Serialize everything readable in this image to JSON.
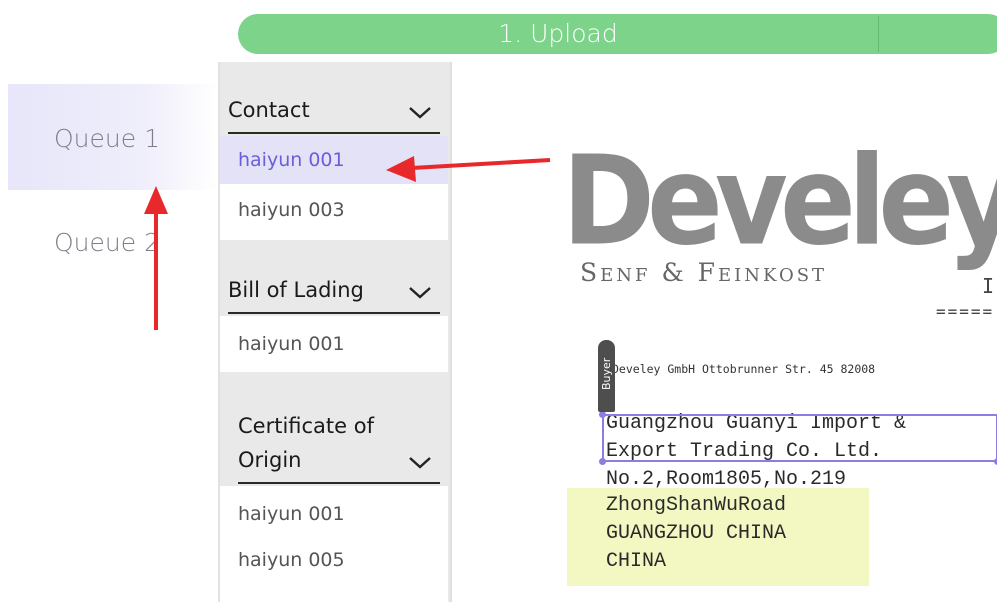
{
  "progress": {
    "step_label": "1. Upload"
  },
  "queues": [
    {
      "label": "Queue 1"
    },
    {
      "label": "Queue 2"
    }
  ],
  "groups": [
    {
      "title": "Contact",
      "items": [
        "haiyun 001",
        "haiyun 003"
      ]
    },
    {
      "title": "Bill of Lading",
      "items": [
        "haiyun 001"
      ]
    },
    {
      "title": "Certificate of Origin",
      "items": [
        "haiyun 001",
        "haiyun 005"
      ]
    }
  ],
  "document": {
    "logo": "Develey",
    "tagline": "Senf & Feinkost",
    "header_letter": "I",
    "header_rule": "=====",
    "sender_line": "Develey GmbH Ottobrunner Str. 45 82008",
    "address_lines": [
      "Guangzhou Guanyi  Import &",
      "Export Trading Co. Ltd.",
      "No.2,Room1805,No.219",
      "ZhongShanWuRoad",
      "GUANGZHOU CHINA",
      "CHINA"
    ],
    "field_tag": "Buyer"
  },
  "colors": {
    "progress": "#7dd38a",
    "selected": "#6a5fd8",
    "annotation_arrow": "#e8282b",
    "bbox": "#8a7fe0",
    "highlight": "#f3f7c2"
  }
}
